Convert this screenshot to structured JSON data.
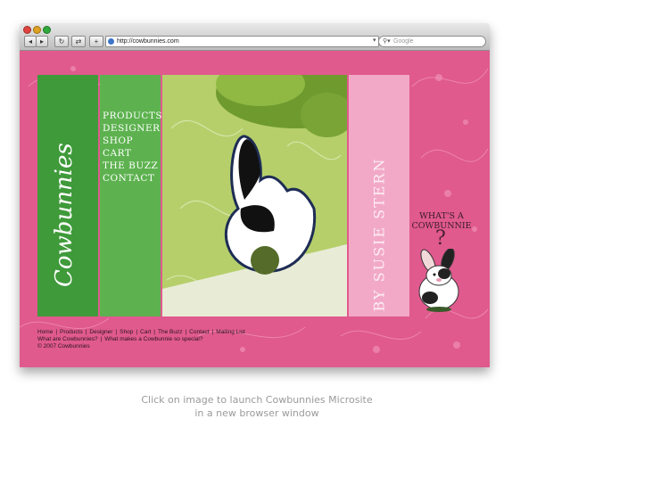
{
  "browser": {
    "url": "http://cowbunnies.com",
    "search_placeholder": "Google"
  },
  "site": {
    "logo_text": "Cowbunnies",
    "nav": [
      "Products",
      "Designer",
      "Shop",
      "Cart",
      "The Buzz",
      "Contact"
    ],
    "byline": "by Susie Stern",
    "whats_line1": "What's a",
    "whats_line2": "Cowbunnie",
    "question_mark": "?",
    "footer_links_row1": [
      "Home",
      "Products",
      "Designer",
      "Shop",
      "Cart",
      "The Buzz",
      "Contact",
      "Mailing List"
    ],
    "footer_links_row2": [
      "What are Cowbunnies?",
      "What makes a Cowbunnie so special?"
    ],
    "copyright": "© 2007 Cowbunnies"
  },
  "caption": {
    "line1": "Click on image to launch Cowbunnies Microsite",
    "line2": "in a new browser window"
  },
  "colors": {
    "page_pink": "#e05a8e",
    "dark_green": "#3f9a3a",
    "light_green": "#5db24f",
    "light_pink": "#f2a9c8"
  },
  "icons": [
    "back-arrow-icon",
    "forward-arrow-icon",
    "reload-icon",
    "snapback-icon",
    "add-bookmark-icon",
    "globe-icon",
    "search-icon"
  ]
}
